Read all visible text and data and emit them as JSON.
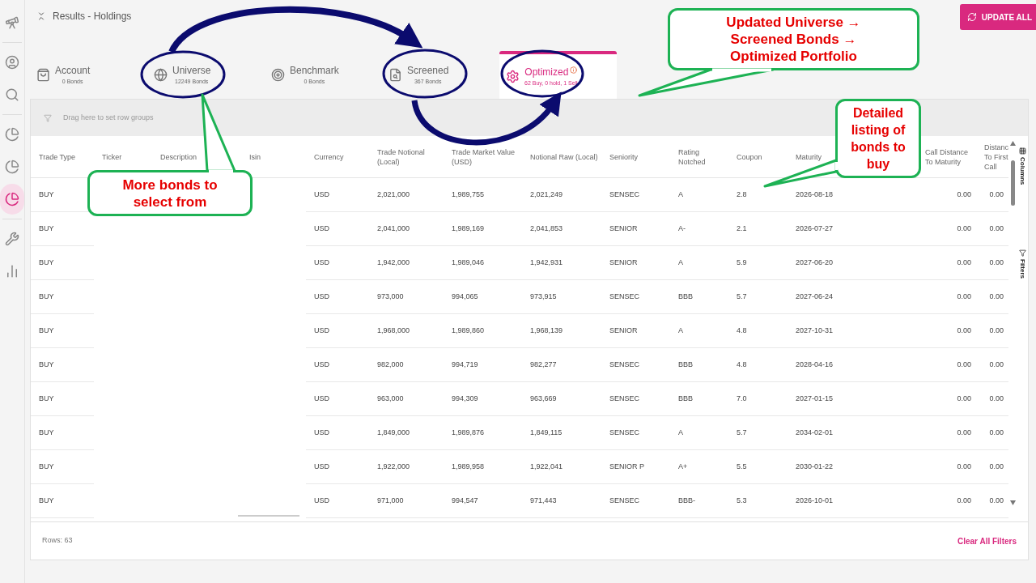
{
  "sidebar": {
    "items": [
      {
        "kind": "telescope",
        "selected": false
      },
      {
        "kind": "user",
        "selected": false
      },
      {
        "kind": "search",
        "selected": false
      },
      {
        "kind": "pie",
        "selected": false
      },
      {
        "kind": "pie-outline",
        "selected": false
      },
      {
        "kind": "pie-search",
        "selected": true
      },
      {
        "kind": "tools",
        "selected": false
      },
      {
        "kind": "bars",
        "selected": false
      }
    ]
  },
  "header": {
    "title": "Results - Holdings",
    "update_button": "UPDATE ALL"
  },
  "tabs": [
    {
      "kind": "bag",
      "label": "Account",
      "count": "0 Bonds",
      "selected": false
    },
    {
      "kind": "globe",
      "label": "Universe",
      "count": "12249 Bonds",
      "selected": false
    },
    {
      "kind": "target",
      "label": "Benchmark",
      "count": "0 Bonds",
      "selected": false
    },
    {
      "kind": "search-doc",
      "label": "Screened",
      "count": "367 Bonds",
      "selected": false
    },
    {
      "kind": "gear",
      "label": "Optimized",
      "count": "62 Buy, 0 hold, 1 Sell",
      "selected": true
    }
  ],
  "grid": {
    "group_hint": "Drag here to set row groups",
    "columns": [
      {
        "label": "Trade Type",
        "kind": "data"
      },
      {
        "label": "Ticker",
        "kind": "blanked"
      },
      {
        "label": "Description",
        "kind": "blanked"
      },
      {
        "label": "Isin",
        "kind": "blanked"
      },
      {
        "label": "Currency",
        "kind": "data"
      },
      {
        "label": "Trade Notional (Local)",
        "kind": "data"
      },
      {
        "label": "Trade Market Value (USD)",
        "kind": "data"
      },
      {
        "label": "Notional Raw (Local)",
        "kind": "data"
      },
      {
        "label": "Seniority",
        "kind": "data"
      },
      {
        "label": "Rating Notched",
        "kind": "data"
      },
      {
        "label": "Coupon",
        "kind": "data"
      },
      {
        "label": "Maturity",
        "kind": "data"
      },
      {
        "kind": "covered"
      },
      {
        "label": "Call Distance To Maturity",
        "kind": "data"
      },
      {
        "label": "Distanc To First Call",
        "kind": "data"
      }
    ],
    "rows": [
      [
        "BUY",
        "",
        "",
        "",
        "USD",
        "2,021,000",
        "1,989,755",
        "2,021,249",
        "SENSEC",
        "A",
        "2.8",
        "2026-08-18",
        "",
        "0.00",
        "0.00"
      ],
      [
        "BUY",
        "",
        "",
        "",
        "USD",
        "2,041,000",
        "1,989,169",
        "2,041,853",
        "SENIOR",
        "A-",
        "2.1",
        "2026-07-27",
        "",
        "0.00",
        "0.00"
      ],
      [
        "BUY",
        "",
        "",
        "",
        "USD",
        "1,942,000",
        "1,989,046",
        "1,942,931",
        "SENIOR",
        "A",
        "5.9",
        "2027-06-20",
        "",
        "0.00",
        "0.00"
      ],
      [
        "BUY",
        "",
        "",
        "",
        "USD",
        "973,000",
        "994,065",
        "973,915",
        "SENSEC",
        "BBB",
        "5.7",
        "2027-06-24",
        "",
        "0.00",
        "0.00"
      ],
      [
        "BUY",
        "",
        "",
        "",
        "USD",
        "1,968,000",
        "1,989,860",
        "1,968,139",
        "SENIOR",
        "A",
        "4.8",
        "2027-10-31",
        "",
        "0.00",
        "0.00"
      ],
      [
        "BUY",
        "",
        "",
        "",
        "USD",
        "982,000",
        "994,719",
        "982,277",
        "SENSEC",
        "BBB",
        "4.8",
        "2028-04-16",
        "",
        "0.00",
        "0.00"
      ],
      [
        "BUY",
        "",
        "",
        "",
        "USD",
        "963,000",
        "994,309",
        "963,669",
        "SENSEC",
        "BBB",
        "7.0",
        "2027-01-15",
        "",
        "0.00",
        "0.00"
      ],
      [
        "BUY",
        "",
        "",
        "",
        "USD",
        "1,849,000",
        "1,989,876",
        "1,849,115",
        "SENSEC",
        "A",
        "5.7",
        "2034-02-01",
        "",
        "0.00",
        "0.00"
      ],
      [
        "BUY",
        "",
        "",
        "",
        "USD",
        "1,922,000",
        "1,989,958",
        "1,922,041",
        "SENIOR P",
        "A+",
        "5.5",
        "2030-01-22",
        "",
        "0.00",
        "0.00"
      ],
      [
        "BUY",
        "",
        "",
        "",
        "USD",
        "971,000",
        "994,547",
        "971,443",
        "SENSEC",
        "BBB-",
        "5.3",
        "2026-10-01",
        "",
        "0.00",
        "0.00"
      ]
    ],
    "side_tabs": [
      {
        "kind": "columns",
        "label": "Columns"
      },
      {
        "kind": "filters",
        "label": "Filters"
      }
    ],
    "footer": {
      "rows_label": "Rows: 63",
      "clear_filters": "Clear All Filters"
    }
  },
  "annotations": [
    {
      "lines": [
        "Updated Universe →",
        "Screened Bonds →",
        "Optimized Portfolio"
      ]
    },
    {
      "lines": [
        "More bonds to",
        "select from"
      ]
    },
    {
      "lines": [
        "Detailed",
        "listing of",
        "bonds to",
        "buy"
      ]
    }
  ]
}
